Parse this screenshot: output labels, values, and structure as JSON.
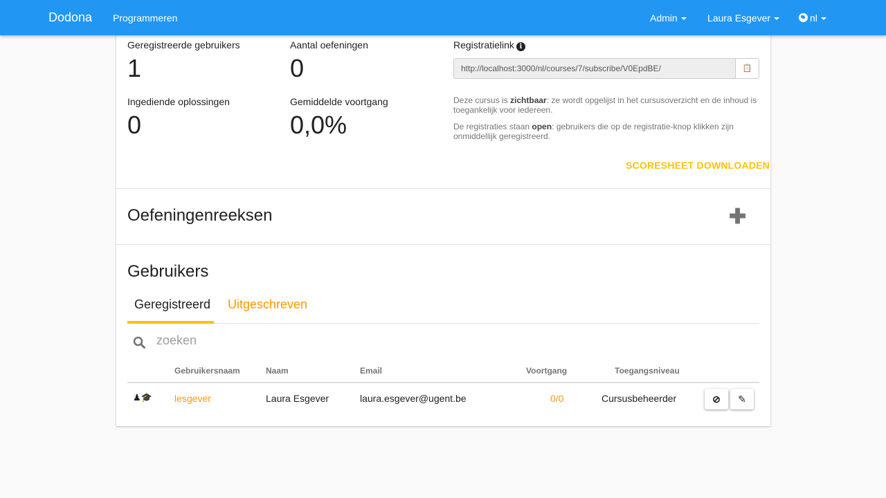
{
  "navbar": {
    "brand": "Dodona",
    "programmeren": "Programmeren",
    "admin": "Admin",
    "user": "Laura Esgever",
    "language": "nl"
  },
  "stats": {
    "registered_label": "Geregistreerde gebruikers",
    "registered_value": "1",
    "exercises_label": "Aantal oefeningen",
    "exercises_value": "0",
    "submissions_label": "Ingediende oplossingen",
    "submissions_value": "0",
    "progress_label": "Gemiddelde voortgang",
    "progress_value": "0,0%"
  },
  "registration": {
    "label": "Registratielink",
    "link": "http://localhost:3000/nl/courses/7/subscribe/V0EpdBE/",
    "visibility_pre": "Deze cursus is ",
    "visibility_bold": "zichtbaar",
    "visibility_post": ": ze wordt opgelijst in het cursusoverzicht en de inhoud is toegankelijk voor iedereen.",
    "registration_pre": "De registraties staan ",
    "registration_bold": "open",
    "registration_post": ": gebruikers die op de registratie-knop klikken zijn onmiddellijk geregistreerd.",
    "scoresheet": "SCORESHEET DOWNLOADEN"
  },
  "series": {
    "title": "Oefeningenreeksen",
    "add_icon": "plus-icon"
  },
  "users": {
    "title": "Gebruikers",
    "tabs": [
      "Geregistreerd",
      "Uitgeschreven"
    ],
    "search_placeholder": "zoeken",
    "columns": [
      "Gebruikersnaam",
      "Naam",
      "Email",
      "Voortgang",
      "Toegangsniveau"
    ],
    "rows": [
      {
        "username": "lesgever",
        "name": "Laura Esgever",
        "email": "laura.esgever@ugent.be",
        "progress": "0/0",
        "access": "Cursusbeheerder"
      }
    ]
  },
  "colors": {
    "navbar": "#2196f3",
    "accent": "#ffc107",
    "link": "#ff9800"
  }
}
